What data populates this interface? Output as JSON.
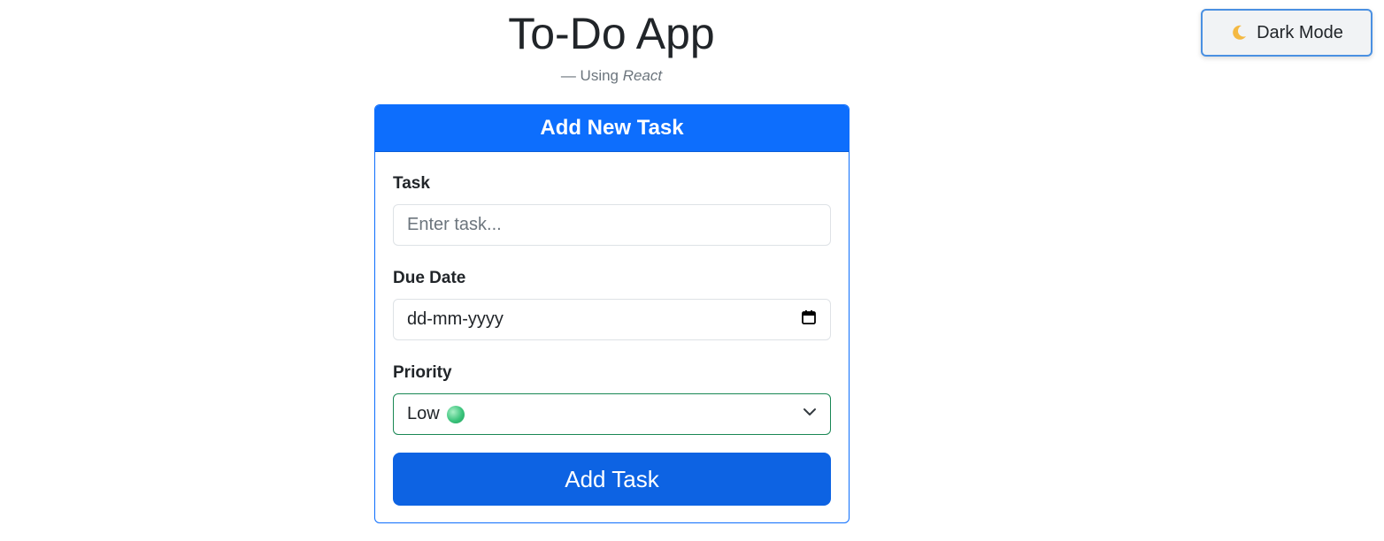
{
  "header": {
    "title": "To-Do App",
    "subtitle_prefix": "— Using",
    "subtitle_em": "React"
  },
  "dark_mode_button": {
    "label": "Dark Mode",
    "icon": "crescent-moon-icon"
  },
  "form": {
    "card_title": "Add New Task",
    "task_label": "Task",
    "task_placeholder": "Enter task...",
    "task_value": "",
    "due_date_label": "Due Date",
    "due_date_value": "dd-mm-yyyy",
    "due_date_icon": "calendar-icon",
    "priority_label": "Priority",
    "priority_value": "Low",
    "priority_icon": "green-circle-icon",
    "priority_dropdown_icon": "chevron-down-icon",
    "submit_label": "Add Task"
  },
  "colors": {
    "primary": "#0d6efd",
    "button": "#0d63e3",
    "priority_border": "#198754"
  }
}
